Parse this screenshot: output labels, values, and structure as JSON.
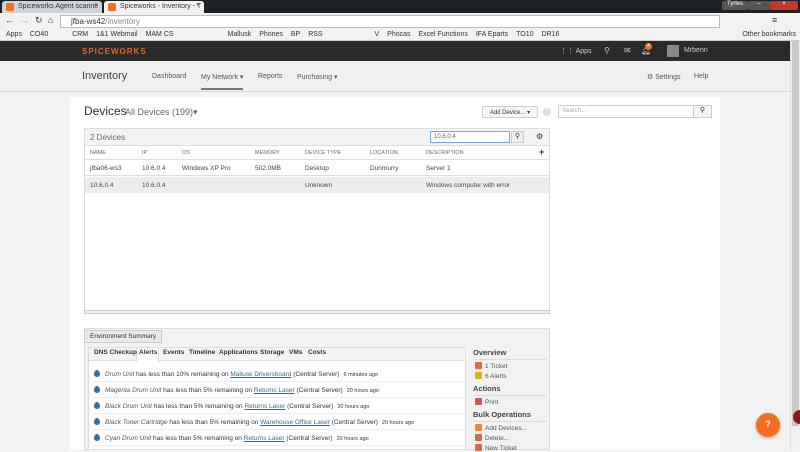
{
  "browser": {
    "tabs": [
      {
        "label": "Spiceworks Agent scanne"
      },
      {
        "label": "Spiceworks - Inventory - T"
      }
    ],
    "user_badge": "Tyrles",
    "url_host": "jfba-ws42",
    "url_path": "/inventory",
    "bookmarks": [
      "Apps",
      "CO40",
      "CRM",
      "1&1 Webmail",
      "MAM CS",
      "Mallusk",
      "Phones",
      "BP",
      "RSS",
      "V",
      "Phocas",
      "Excel Functions",
      "IFA Eparts",
      "TO10",
      "DR16"
    ],
    "other_bookmarks": "Other bookmarks"
  },
  "header": {
    "logo": "SPICEWORKS",
    "apps": "Apps",
    "notifications": "4",
    "user": "Mrbenn"
  },
  "subnav": {
    "title": "Inventory",
    "items": [
      "Dashboard",
      "My Network ▾",
      "Reports",
      "Purchasing ▾"
    ],
    "settings": "Settings",
    "help": "Help"
  },
  "devices": {
    "title": "Devices",
    "filter": "All Devices (199)",
    "add_device": "Add Device... ▾",
    "search_placeholder": "Search...",
    "count": "2 Devices",
    "filter_value": "10.6.0.4",
    "columns": [
      "NAME",
      "IP",
      "OS",
      "MEMORY",
      "DEVICE TYPE",
      "LOCATION",
      "DESCRIPTION"
    ],
    "rows": [
      [
        "jfba06-ws3",
        "10.6.0.4",
        "Windows XP Pro",
        "502.0MB",
        "Desktop",
        "Dunmurry",
        "Server 1"
      ],
      [
        "10.6.0.4",
        "10.6.0.4",
        "",
        "",
        "Unknown",
        "",
        "Windows computer with error"
      ]
    ]
  },
  "summary": {
    "tab": "Environment Summary",
    "tabs": [
      "DNS Checkup",
      "Alerts",
      "Events",
      "Timeline",
      "Applications",
      "Storage",
      "VMs",
      "Costs"
    ],
    "alerts": [
      {
        "item": "Drum Unit",
        "text": " has less than 10% remaining on ",
        "device": "Mallusk Driversboard",
        "server": " (Central Server)",
        "ago": "6 minutes ago"
      },
      {
        "item": "Magenta Drum Unit",
        "text": " has less than 5% remaining on ",
        "device": "Returns Laser",
        "server": " (Central Server)",
        "ago": "20 hours ago"
      },
      {
        "item": "Black Drum Unit",
        "text": " has less than 5% remaining on ",
        "device": "Returns Laser",
        "server": " (Central Server)",
        "ago": "20 hours ago"
      },
      {
        "item": "Black Toner Cartridge",
        "text": " has less than 5% remaining on ",
        "device": "Warehouse Office Laser",
        "server": " (Central Server)",
        "ago": "20 hours ago"
      },
      {
        "item": "Cyan Drum Unit",
        "text": " has less than 5% remaining on ",
        "device": "Returns Laser",
        "server": " (Central Server)",
        "ago": "20 hours ago"
      }
    ],
    "overview": {
      "title": "Overview",
      "ticket": "1 Ticket",
      "alerts": "6 Alerts"
    },
    "actions": {
      "title": "Actions",
      "print": "Print"
    },
    "bulk": {
      "title": "Bulk Operations",
      "add": "Add Devices...",
      "delete": "Delete...",
      "ticket": "New Ticket"
    }
  },
  "help_bubble": "?"
}
